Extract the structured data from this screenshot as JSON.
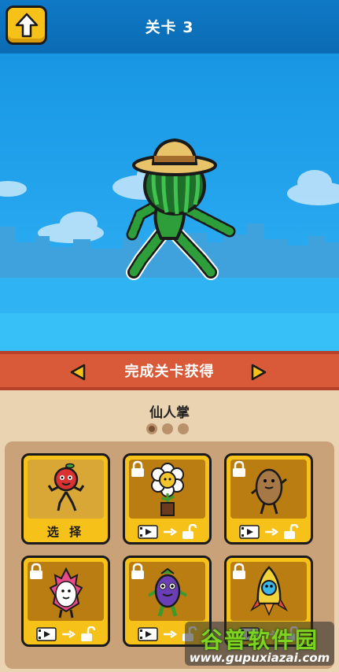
{
  "header": {
    "title": "关卡 3",
    "back_icon": "arrow-up-icon"
  },
  "scene": {
    "character": "watermelon-stickman-with-straw-hat"
  },
  "banner": {
    "text": "完成关卡获得",
    "left_icon": "triangle-left-icon",
    "right_icon": "triangle-right-icon"
  },
  "character_name": "仙人掌",
  "pager": {
    "pages": 3,
    "current": 1
  },
  "cards": [
    {
      "character": "apple",
      "status": "selected",
      "label": "选 择"
    },
    {
      "character": "flower",
      "status": "locked"
    },
    {
      "character": "potato",
      "status": "locked"
    },
    {
      "character": "dragonfruit",
      "status": "locked"
    },
    {
      "character": "eggplant",
      "status": "locked"
    },
    {
      "character": "banana-rocket",
      "status": "locked"
    }
  ],
  "watermark": {
    "title": "谷普软件园",
    "url": "www.gupuxiazai.com"
  },
  "colors": {
    "header": "#0b6bb3",
    "sky": "#26a6ee",
    "banner": "#d85a38",
    "card": "#f6c21a",
    "panel": "#ead3b0"
  }
}
